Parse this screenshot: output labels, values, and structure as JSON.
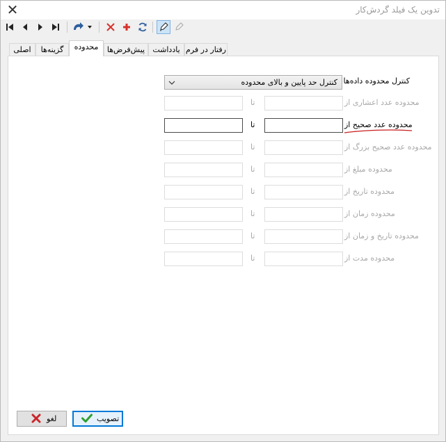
{
  "window": {
    "title": "تدوین یک فیلد گردش‌کار",
    "close_glyph": "✕"
  },
  "toolbar": {
    "buttons": [
      {
        "name": "first-record-icon"
      },
      {
        "name": "prev-record-icon"
      },
      {
        "name": "next-record-icon"
      },
      {
        "name": "last-record-icon"
      },
      {
        "name": "redo-dropdown-icon"
      },
      {
        "name": "delete-icon"
      },
      {
        "name": "add-icon"
      },
      {
        "name": "refresh-icon"
      },
      {
        "name": "edit-pencil-icon"
      },
      {
        "name": "edit-pencil-disabled-icon"
      }
    ]
  },
  "tabs": [
    {
      "label": "اصلی"
    },
    {
      "label": "گزینه‌ها"
    },
    {
      "label": "محدوده",
      "active": true
    },
    {
      "label": "پیش‌فرض‌ها"
    },
    {
      "label": "یادداشت"
    },
    {
      "label": "رفتار در فرم"
    }
  ],
  "range": {
    "control_label": "کنترل محدوده داده‌ها",
    "control_value": "کنترل حد پایین و بالای محدوده",
    "to_label": "تا",
    "rows": [
      {
        "label": "محدوده عدد اعشاری از",
        "enabled": false,
        "from": "",
        "to": ""
      },
      {
        "label": "محدوده عدد صحیح از",
        "enabled": true,
        "from": "",
        "to": ""
      },
      {
        "label": "محدوده عدد صحیح بزرگ از",
        "enabled": false,
        "from": "",
        "to": ""
      },
      {
        "label": "محدوده مبلغ از",
        "enabled": false,
        "from": "",
        "to": ""
      },
      {
        "label": "محدوده تاریخ از",
        "enabled": false,
        "from": "",
        "to": ""
      },
      {
        "label": "محدوده زمان از",
        "enabled": false,
        "from": "",
        "to": ""
      },
      {
        "label": "محدوده تاریخ و زمان از",
        "enabled": false,
        "from": "",
        "to": ""
      },
      {
        "label": "محدوده مدت از",
        "enabled": false,
        "from": "",
        "to": ""
      }
    ]
  },
  "footer": {
    "ok_label": "تصویب",
    "cancel_label": "لغو"
  },
  "colors": {
    "accent": "#0078d7",
    "delete": "#d9302c",
    "add": "#d9302c",
    "ok_icon": "#2f9e2f",
    "cancel_icon": "#c9262b",
    "annotation_line": "#c81e1e"
  }
}
